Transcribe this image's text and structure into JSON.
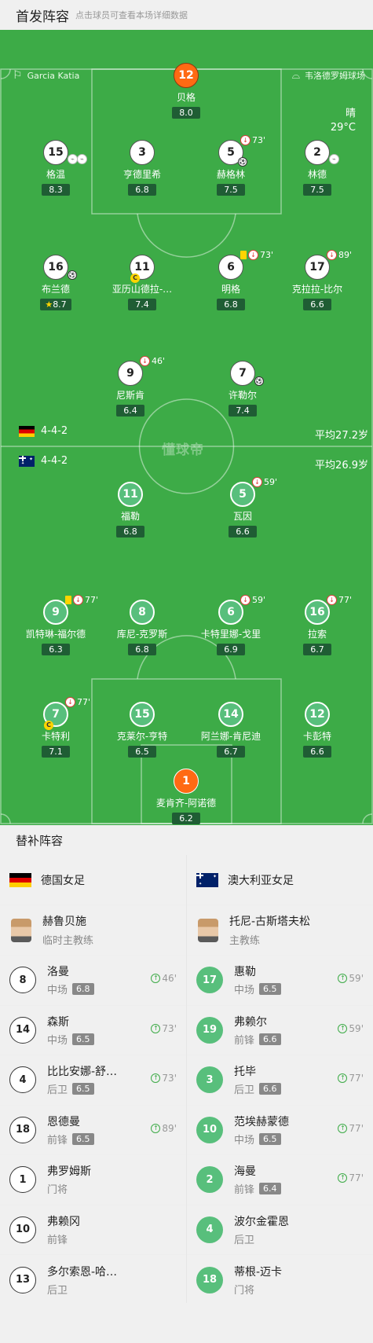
{
  "header": {
    "title": "首发阵容",
    "subtitle": "点击球员可查看本场详细数据"
  },
  "pitch": {
    "referee": "Garcia Katia",
    "venue": "韦洛德罗姆球场",
    "weather": "晴",
    "temperature": "29°C",
    "watermark": "懂球帝",
    "home_formation": "4-4-2",
    "home_avg_age": "平均27.2岁",
    "away_formation": "4-4-2",
    "away_avg_age": "平均26.9岁",
    "accent_color": "#3dab47"
  },
  "home_players": [
    {
      "num": "12",
      "name": "贝格",
      "rating": "8.0"
    },
    {
      "num": "15",
      "name": "格温",
      "rating": "8.3"
    },
    {
      "num": "3",
      "name": "亨德里希",
      "rating": "6.8"
    },
    {
      "num": "5",
      "name": "赫格林",
      "rating": "7.5",
      "sub": "73'"
    },
    {
      "num": "2",
      "name": "林德",
      "rating": "7.5"
    },
    {
      "num": "16",
      "name": "布兰德",
      "rating": "8.7"
    },
    {
      "num": "11",
      "name": "亚历山德拉-…",
      "rating": "7.4"
    },
    {
      "num": "6",
      "name": "明格",
      "rating": "6.8",
      "sub": "73'"
    },
    {
      "num": "17",
      "name": "克拉拉-比尔",
      "rating": "6.6",
      "sub": "89'"
    },
    {
      "num": "9",
      "name": "尼斯肯",
      "rating": "6.4",
      "sub": "46'"
    },
    {
      "num": "7",
      "name": "许勒尔",
      "rating": "7.4"
    }
  ],
  "away_players": [
    {
      "num": "11",
      "name": "福勒",
      "rating": "6.8"
    },
    {
      "num": "5",
      "name": "瓦因",
      "rating": "6.6",
      "sub": "59'"
    },
    {
      "num": "9",
      "name": "凯特琳-福尔德",
      "rating": "6.3",
      "sub": "77'"
    },
    {
      "num": "8",
      "name": "库尼-克罗斯",
      "rating": "6.8"
    },
    {
      "num": "6",
      "name": "卡特里娜-戈里",
      "rating": "6.9",
      "sub": "59'"
    },
    {
      "num": "16",
      "name": "拉索",
      "rating": "6.7",
      "sub": "77'"
    },
    {
      "num": "7",
      "name": "卡特利",
      "rating": "7.1",
      "sub": "77'"
    },
    {
      "num": "15",
      "name": "克莱尔-亨特",
      "rating": "6.5"
    },
    {
      "num": "14",
      "name": "阿兰娜-肯尼迪",
      "rating": "6.7"
    },
    {
      "num": "12",
      "name": "卡彭特",
      "rating": "6.6"
    },
    {
      "num": "1",
      "name": "麦肯齐-阿诺德",
      "rating": "6.2"
    }
  ],
  "subs": {
    "title": "替补阵容",
    "home": {
      "team": "德国女足",
      "coach": {
        "name": "赫鲁贝施",
        "role": "临时主教练"
      },
      "players": [
        {
          "num": "8",
          "name": "洛曼",
          "pos": "中场",
          "rating": "6.8",
          "in": "46'"
        },
        {
          "num": "14",
          "name": "森斯",
          "pos": "中场",
          "rating": "6.5",
          "in": "73'"
        },
        {
          "num": "4",
          "name": "比比安娜-舒…",
          "pos": "后卫",
          "rating": "6.5",
          "in": "73'"
        },
        {
          "num": "18",
          "name": "恩德曼",
          "pos": "前锋",
          "rating": "6.5",
          "in": "89'"
        },
        {
          "num": "1",
          "name": "弗罗姆斯",
          "pos": "门将"
        },
        {
          "num": "10",
          "name": "弗赖冈",
          "pos": "前锋"
        },
        {
          "num": "13",
          "name": "多尔索恩-哈…",
          "pos": "后卫"
        }
      ]
    },
    "away": {
      "team": "澳大利亚女足",
      "coach": {
        "name": "托尼-古斯塔夫松",
        "role": "主教练"
      },
      "players": [
        {
          "num": "17",
          "name": "惠勒",
          "pos": "中场",
          "rating": "6.5",
          "in": "59'"
        },
        {
          "num": "19",
          "name": "弗赖尔",
          "pos": "前锋",
          "rating": "6.6",
          "in": "59'"
        },
        {
          "num": "3",
          "name": "托毕",
          "pos": "后卫",
          "rating": "6.6",
          "in": "77'"
        },
        {
          "num": "10",
          "name": "范埃赫蒙德",
          "pos": "中场",
          "rating": "6.5",
          "in": "77'"
        },
        {
          "num": "2",
          "name": "海曼",
          "pos": "前锋",
          "rating": "6.4",
          "in": "77'"
        },
        {
          "num": "4",
          "name": "波尔金霍恩",
          "pos": "后卫"
        },
        {
          "num": "18",
          "name": "蒂根-迈卡",
          "pos": "门将"
        }
      ]
    }
  }
}
